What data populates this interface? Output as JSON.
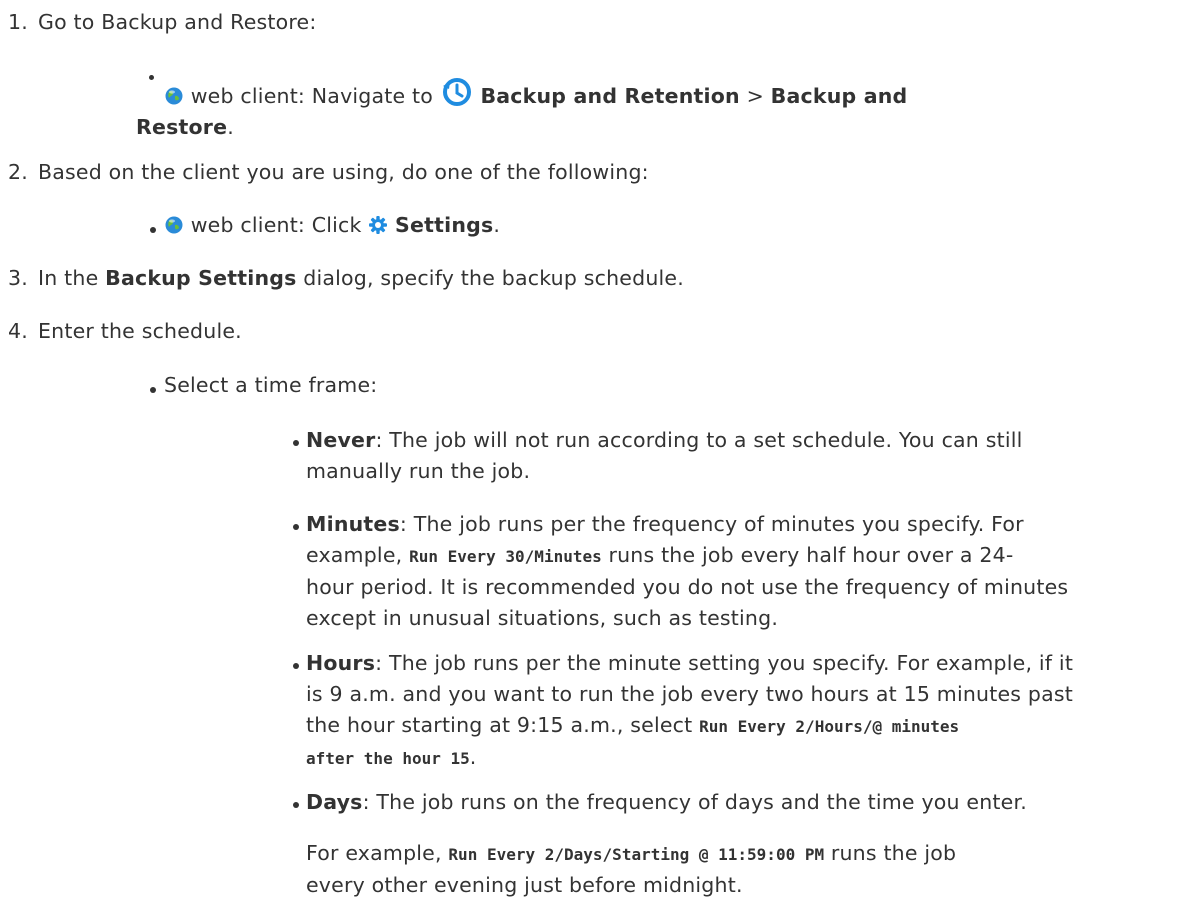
{
  "steps": [
    {
      "number": "1.",
      "text": "Go to Backup and Restore:",
      "sub": {
        "client": "web client:",
        "navigate": "Navigate to",
        "menu1": "Backup and Retention",
        "sep": ">",
        "menu2_line1": "Backup and",
        "menu2_line2": "Restore",
        "end": "."
      }
    },
    {
      "number": "2.",
      "text": "Based on the client you are using, do one of the following:",
      "sub": {
        "client": "web client: Click",
        "settings": "Settings",
        "end": "."
      }
    },
    {
      "number": "3.",
      "pre": "In the",
      "bold": "Backup Settings",
      "post": "dialog, specify the backup schedule."
    },
    {
      "number": "4.",
      "text": "Enter the schedule.",
      "sub": {
        "text": "Select a time frame:"
      }
    }
  ],
  "options": [
    {
      "term": "Never",
      "lines": [
        ": The job will not run according to a set schedule. You can still",
        "manually run the job."
      ]
    },
    {
      "term": "Minutes",
      "line1": ": The job runs per the frequency of minutes you specify. For",
      "line2_pre": "example,",
      "line2_code": "Run Every 30/Minutes",
      "line2_post": "runs the job every half hour over a 24-",
      "line3": "hour period. It is recommended you do not use the frequency of minutes",
      "line4": "except in unusual situations, such as testing."
    },
    {
      "term": "Hours",
      "line1": ": The job runs per the minute setting you specify. For example, if it",
      "line2": "is 9 a.m. and you want to run the job every two hours at 15 minutes past",
      "line3_pre": "the hour starting at 9:15 a.m., select",
      "line3_code": "Run Every 2/Hours/@ minutes",
      "line4_code": "after the hour 15",
      "line4_post": "."
    },
    {
      "term": "Days",
      "line1": ": The job runs on the frequency of days and the time you enter.",
      "line2_pre": "For example,",
      "line2_code": "Run Every 2/Days/Starting @ 11:59:00 PM",
      "line2_post": "runs the job",
      "line3": "every other evening just before midnight."
    }
  ],
  "colors": {
    "text": "#333333",
    "globe_blue": "#2a8bd8",
    "globe_green": "#6bbf3a",
    "icon_blue": "#1f8ce0"
  },
  "icons": [
    "globe-icon",
    "clock-icon",
    "gear-icon"
  ]
}
